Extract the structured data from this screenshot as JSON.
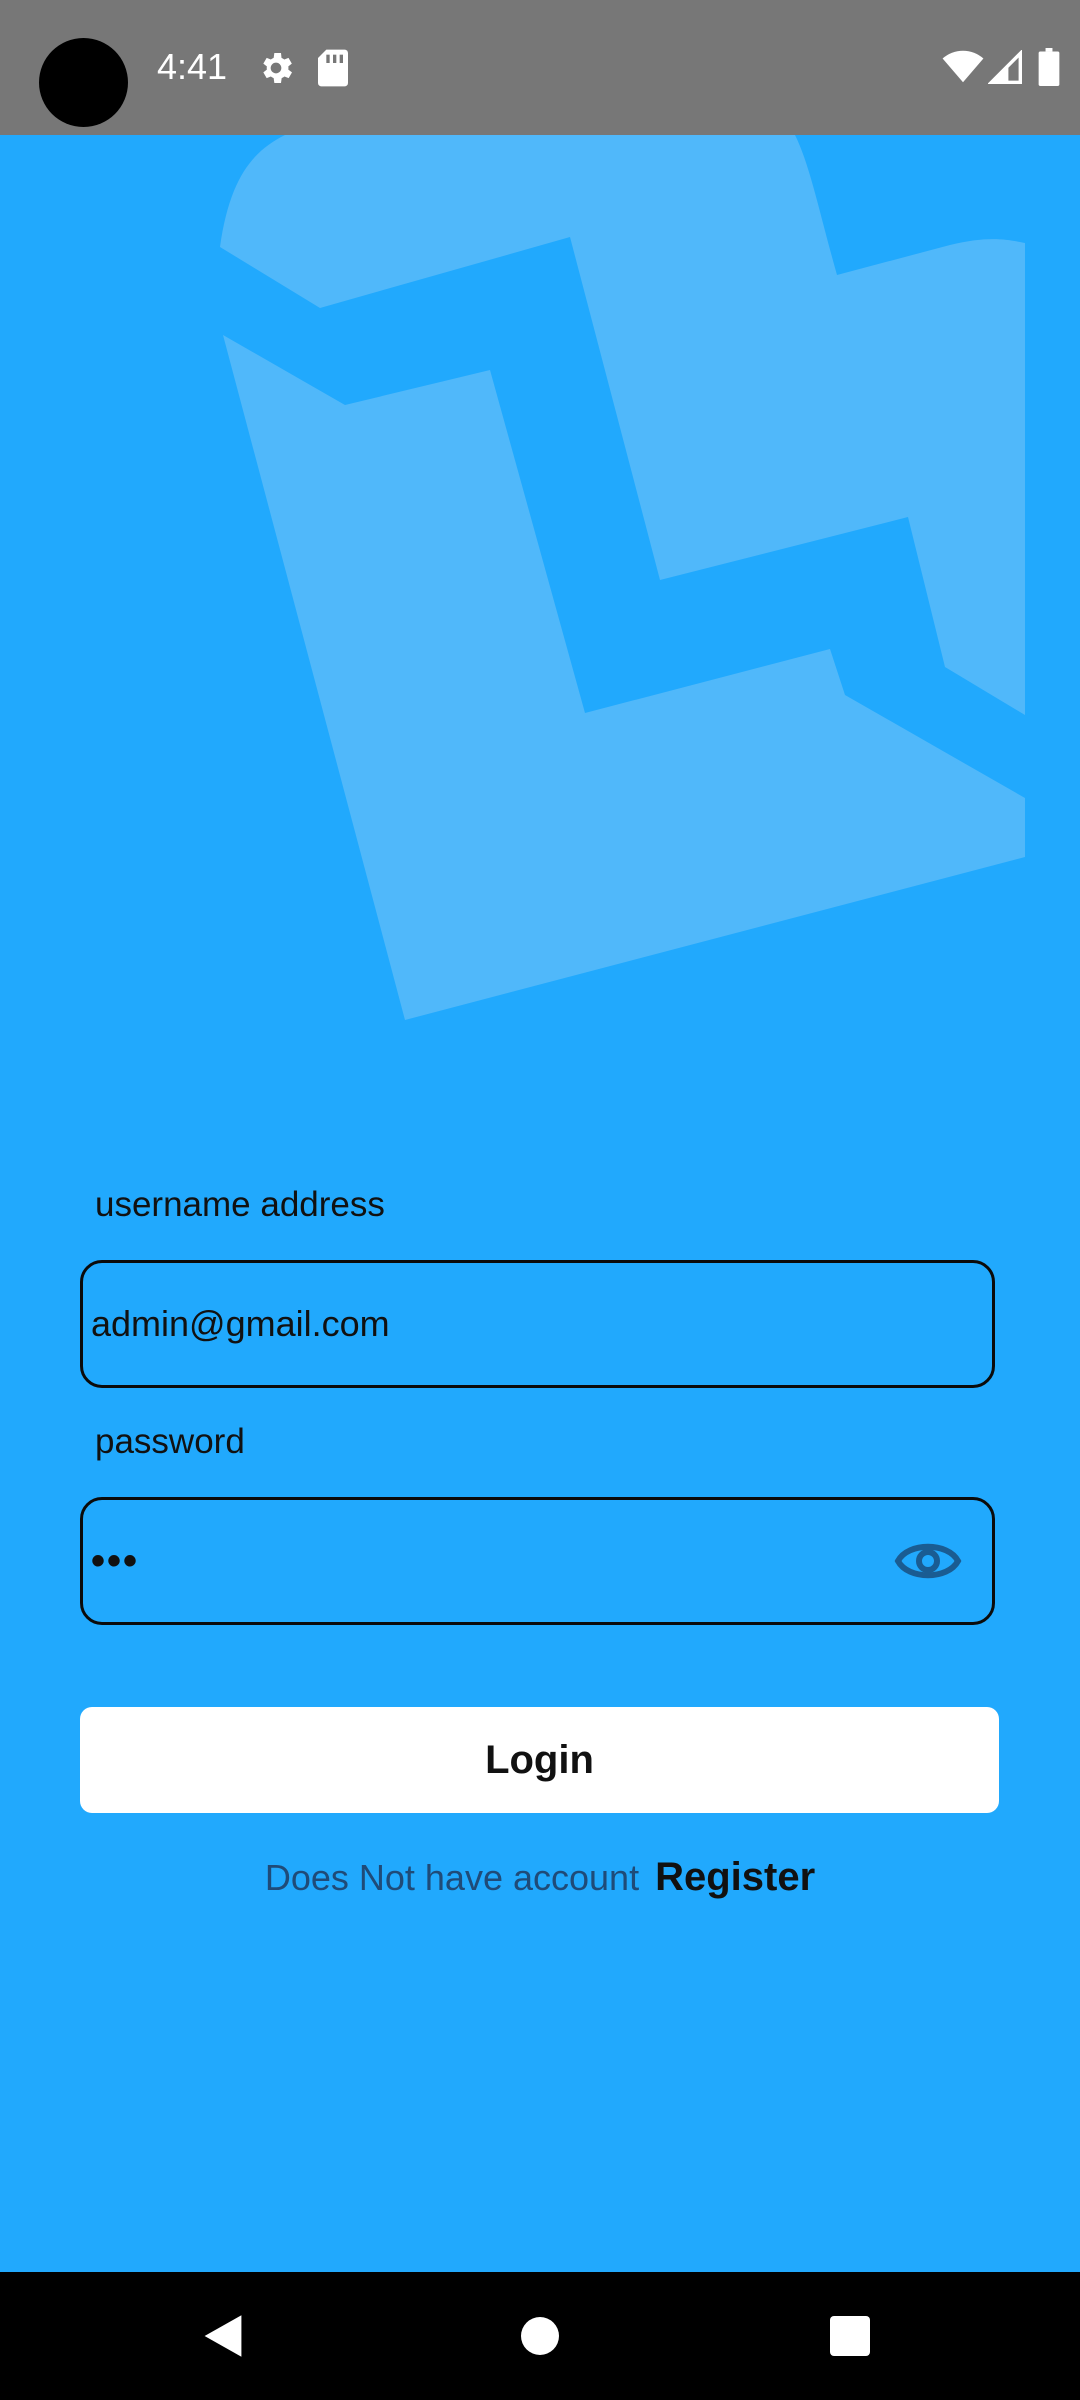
{
  "status_bar": {
    "time": "4:41",
    "icons": [
      "settings-icon",
      "sd-card-icon",
      "wifi-icon",
      "cell-signal-icon",
      "battery-icon"
    ]
  },
  "colors": {
    "background": "#21a9fd",
    "status_bar": "#777777",
    "logo_watermark": "#50b8fa",
    "button": "#ffffff",
    "nav_bar": "#000000"
  },
  "form": {
    "username_label": "username address",
    "username_value": "admin@gmail.com",
    "password_label": "password",
    "password_value": "•••",
    "login_label": "Login",
    "register_prompt": "Does Not have account",
    "register_link": "Register"
  },
  "nav": {
    "icons": [
      "back-icon",
      "home-icon",
      "recents-icon"
    ]
  }
}
